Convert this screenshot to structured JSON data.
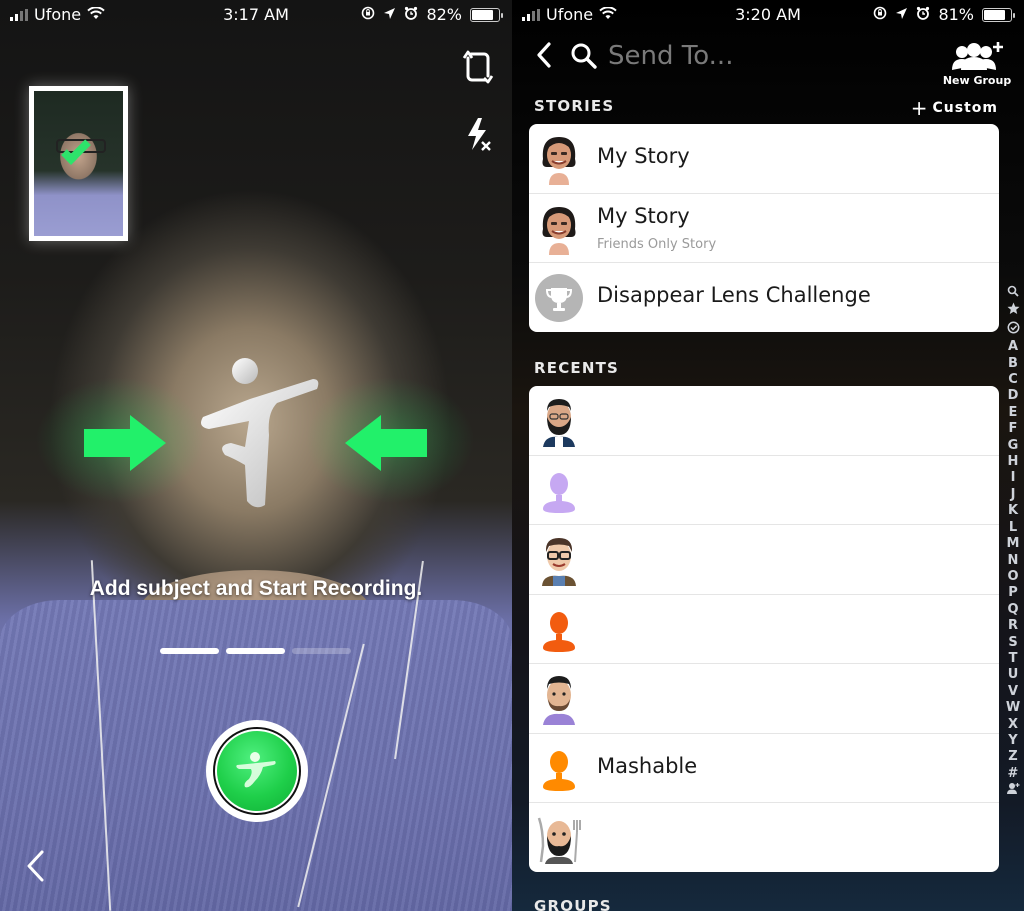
{
  "left_screen": {
    "status": {
      "carrier": "Ufone",
      "time": "3:17 AM",
      "battery": "82%",
      "battery_level": 0.82
    },
    "icons": [
      "flip-camera-icon",
      "flash-off-icon",
      "back-chevron-icon"
    ],
    "hint_text": "Add subject and Start Recording.",
    "step_progress": {
      "total": 3,
      "completed": 2
    },
    "capture_button": {
      "icon": "dancing-figure-icon",
      "color": "#1fcf4a"
    }
  },
  "right_screen": {
    "status": {
      "carrier": "Ufone",
      "time": "3:20 AM",
      "battery": "81%",
      "battery_level": 0.81
    },
    "search": {
      "placeholder": "Send To..."
    },
    "new_group_label": "New Group",
    "stories": {
      "heading": "STORIES",
      "custom_label": "Custom",
      "items": [
        {
          "title": "My Story",
          "subtitle": "",
          "avatar": "bitmoji-woman"
        },
        {
          "title": "My Story",
          "subtitle": "Friends Only Story",
          "avatar": "bitmoji-woman"
        },
        {
          "title": "Disappear Lens Challenge",
          "subtitle": "",
          "avatar": "trophy-icon"
        }
      ]
    },
    "recents": {
      "heading": "RECENTS",
      "items": [
        {
          "name": "",
          "avatar": "bitmoji-bearded-man",
          "color": "#1d3a5f"
        },
        {
          "name": "",
          "avatar": "silhouette",
          "color": "#c6a8f2"
        },
        {
          "name": "",
          "avatar": "bitmoji-glasses-man",
          "color": "#5a4636"
        },
        {
          "name": "",
          "avatar": "silhouette",
          "color": "#f25c0f"
        },
        {
          "name": "",
          "avatar": "bitmoji-beard-man-purple",
          "color": "#9a82d6"
        },
        {
          "name": "Mashable",
          "avatar": "silhouette",
          "color": "#ff8a00"
        },
        {
          "name": "",
          "avatar": "bitmoji-chef",
          "color": "#3a2a22"
        }
      ]
    },
    "groups_heading": "GROUPS",
    "alpha_index": [
      "search",
      "star",
      "check",
      "A",
      "B",
      "C",
      "D",
      "E",
      "F",
      "G",
      "H",
      "I",
      "J",
      "K",
      "L",
      "M",
      "N",
      "O",
      "P",
      "Q",
      "R",
      "S",
      "T",
      "U",
      "V",
      "W",
      "X",
      "Y",
      "Z",
      "#",
      "add-friend"
    ]
  }
}
